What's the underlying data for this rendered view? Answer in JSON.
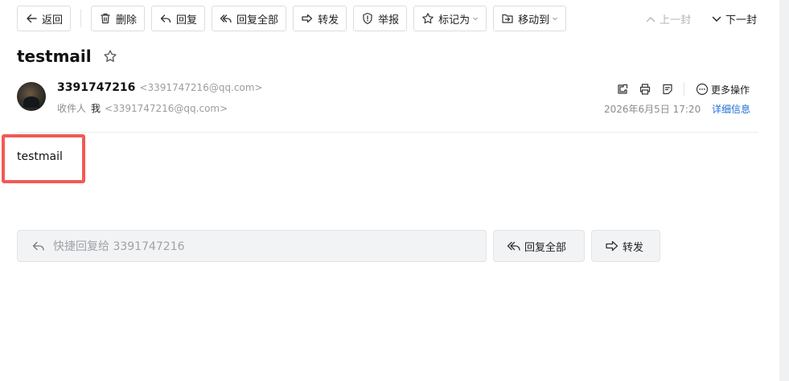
{
  "toolbar": {
    "back": "返回",
    "delete": "删除",
    "reply": "回复",
    "reply_all": "回复全部",
    "forward": "转发",
    "report": "举报",
    "mark_as": "标记为",
    "move_to": "移动到"
  },
  "nav": {
    "prev": "上一封",
    "next": "下一封"
  },
  "mail": {
    "subject": "testmail",
    "sender_name": "3391747216",
    "sender_email": "<3391747216@qq.com>",
    "recipient_label": "收件人",
    "recipient_name": "我",
    "recipient_email": "<3391747216@qq.com>",
    "date": "2026年6月5日 17:20",
    "details_link": "详细信息",
    "more_actions": "更多操作",
    "body": "testmail"
  },
  "bottom": {
    "quick_reply_placeholder": "快捷回复给 3391747216",
    "reply_all": "回复全部",
    "forward": "转发"
  },
  "colors": {
    "highlight_border": "#f25a55",
    "link": "#1d6fd8"
  }
}
